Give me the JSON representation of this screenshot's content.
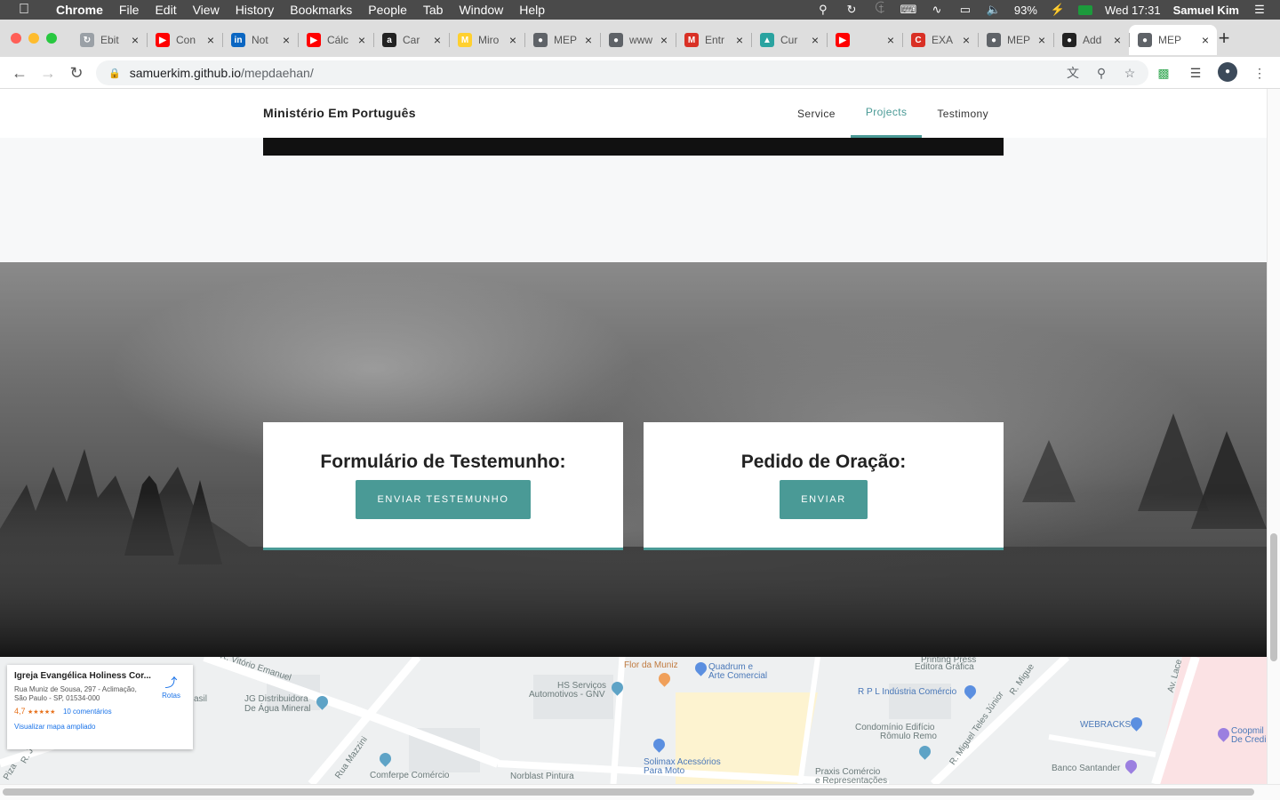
{
  "menubar": {
    "app": "Chrome",
    "items": [
      "File",
      "Edit",
      "View",
      "History",
      "Bookmarks",
      "People",
      "Tab",
      "Window",
      "Help"
    ],
    "battery": "93%",
    "clock": "Wed 17:31",
    "user": "Samuel Kim"
  },
  "tabs": [
    {
      "title": "Ebit",
      "icon": "loading-icon",
      "color": "#9aa0a6"
    },
    {
      "title": "Con",
      "icon": "youtube-icon",
      "color": "#ff0000"
    },
    {
      "title": "Not",
      "icon": "linkedin-icon",
      "color": "#0a66c2"
    },
    {
      "title": "Cálc",
      "icon": "youtube-icon",
      "color": "#ff0000"
    },
    {
      "title": "Car",
      "icon": "amazon-icon",
      "color": "#222222"
    },
    {
      "title": "Miro",
      "icon": "miro-icon",
      "color": "#ffd02f"
    },
    {
      "title": "MEP",
      "icon": "globe-icon",
      "color": "#5f6368"
    },
    {
      "title": "www",
      "icon": "globe-icon",
      "color": "#5f6368"
    },
    {
      "title": "Entr",
      "icon": "gmail-icon",
      "color": "#d93025"
    },
    {
      "title": "Cur",
      "icon": "course-icon",
      "color": "#2aa3a0"
    },
    {
      "title": "",
      "icon": "youtube-audio-icon",
      "color": "#ff0000"
    },
    {
      "title": "EXA",
      "icon": "exam-icon",
      "color": "#d93025"
    },
    {
      "title": "MEP",
      "icon": "globe-icon",
      "color": "#5f6368"
    },
    {
      "title": "Add",
      "icon": "github-icon",
      "color": "#222222"
    },
    {
      "title": "MEP",
      "icon": "globe-icon",
      "color": "#5f6368",
      "active": true
    }
  ],
  "address": {
    "host": "samuerkim.github.io",
    "path": "/mepdaehan/"
  },
  "site": {
    "brand": "Ministério Em Português",
    "nav": [
      {
        "label": "Service"
      },
      {
        "label": "Projects",
        "active": true
      },
      {
        "label": "Testimony"
      }
    ],
    "accent": "#4a9a96"
  },
  "cards": [
    {
      "title": "Formulário de Testemunho:",
      "button": "ENVIAR TESTEMUNHO"
    },
    {
      "title": "Pedido de Oração:",
      "button": "ENVIAR"
    }
  ],
  "map": {
    "place_title": "Igreja Evangélica Holiness Cor...",
    "address": "Rua Muniz de Sousa, 297 - Aclimação, São Paulo - SP, 01534-000",
    "rating": "4,7",
    "stars": "★★★★★",
    "reviews": "10 comentários",
    "routes": "Rotas",
    "enlarge": "Visualizar mapa ampliado",
    "labels": {
      "street1": "R. Vitório Emanuel",
      "jg1": "JG Distribuidora",
      "jg2": "De Água Mineral",
      "asil": "asil",
      "mazzini": "Rua Mazzini",
      "comferpe": "Comferpe Comércio",
      "flor": "Flor da Muniz",
      "hs1": "HS Serviços",
      "hs2": "Automotivos - GNV",
      "quad1": "Quadrum e",
      "quad2": "Arte Comercial",
      "solimax1": "Solimax Acessórios",
      "solimax2": "Para Moto",
      "norblast": "Norblast Pintura",
      "printing1": "Printing Press",
      "printing2": "Editora Gráfica",
      "rpl": "R P L Indústria Comércio",
      "condo1": "Condomínio Edifício",
      "condo2": "Rômulo Remo",
      "praxis1": "Praxis Comércio",
      "praxis2": "e Representações",
      "teles": "R. Miguel Teles Júnior",
      "rmigue": "R. Migue",
      "webracks": "WEBRACKS",
      "av": "Av. Lace",
      "coop1": "Coopmil",
      "coop2": "De Credi",
      "santander": "Banco Santander",
      "piza": "Piza",
      "rj": "R. J"
    }
  }
}
